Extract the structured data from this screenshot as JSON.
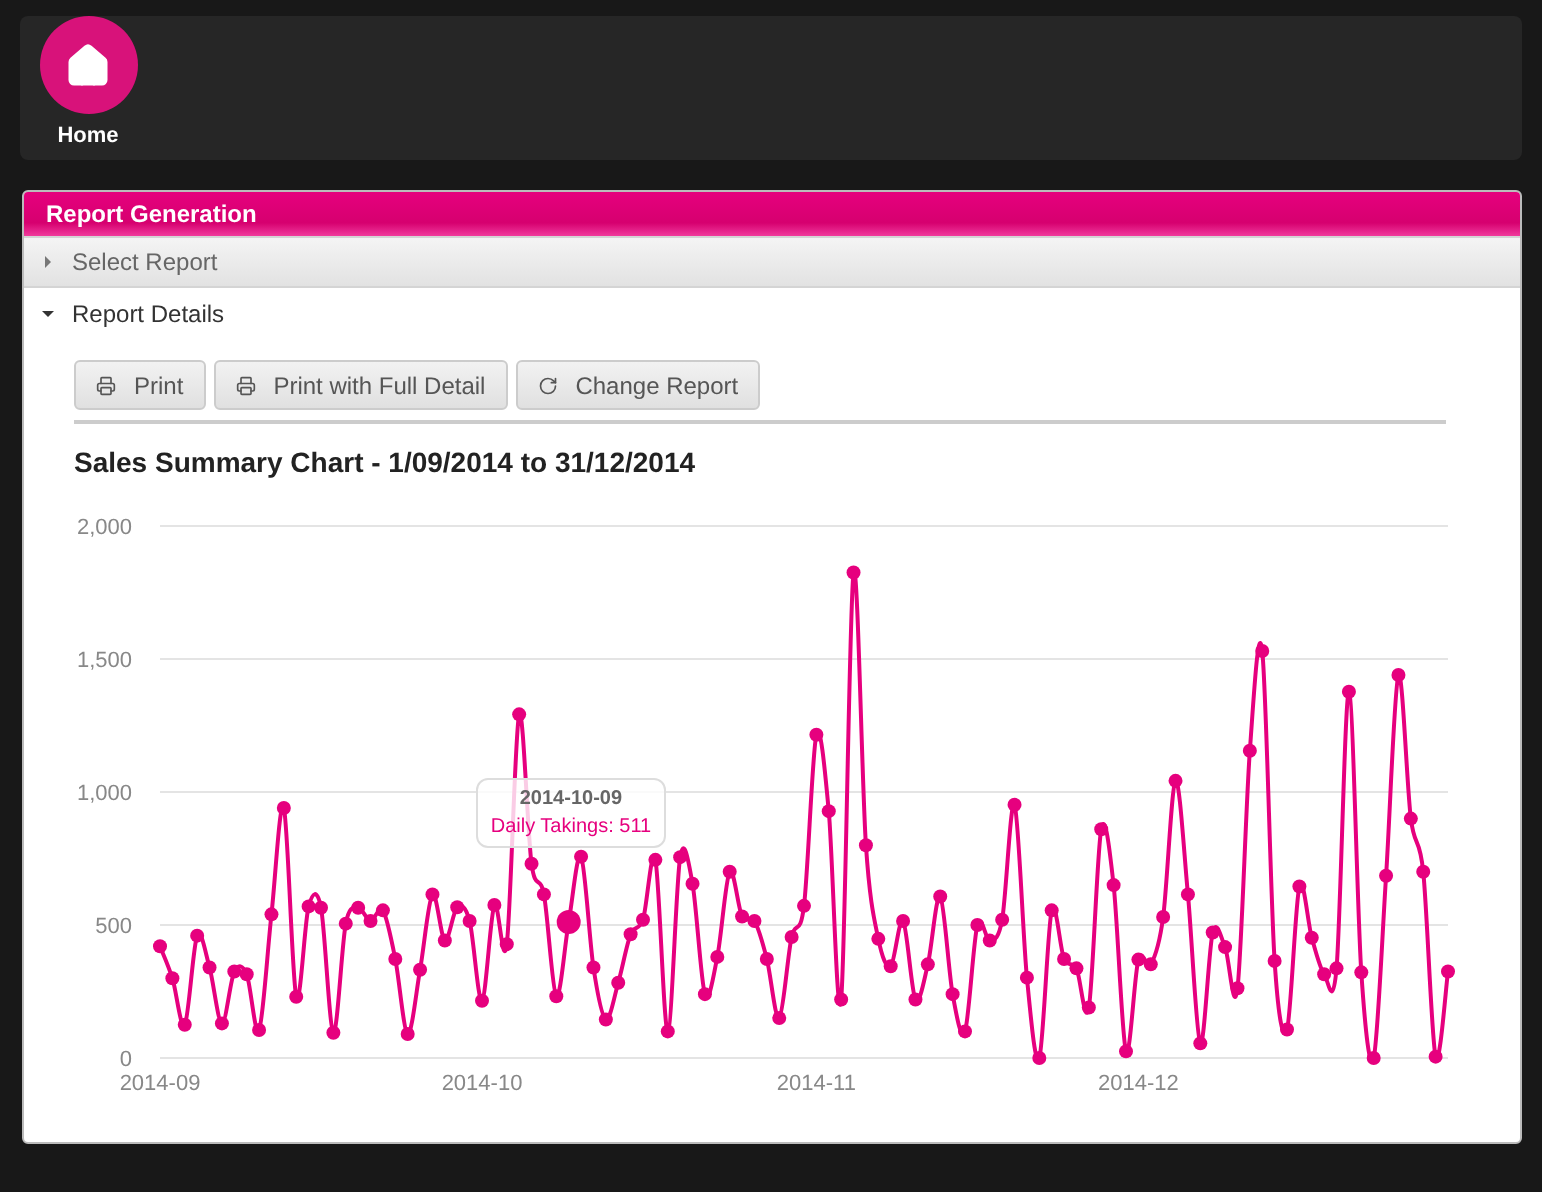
{
  "nav": {
    "items": [
      {
        "label": "Home",
        "selected": true
      }
    ]
  },
  "panel": {
    "title": "Report Generation",
    "sections": [
      {
        "label": "Select Report",
        "expanded": false
      },
      {
        "label": "Report Details",
        "expanded": true
      }
    ],
    "buttons": [
      {
        "label": "Print",
        "kind": "print"
      },
      {
        "label": "Print with Full Detail",
        "kind": "print"
      },
      {
        "label": "Change Report",
        "kind": "change"
      }
    ],
    "report_title": "Sales Summary Chart - 1/09/2014 to 31/12/2014",
    "tooltip": {
      "date": "2014-10-09",
      "text": "Daily Takings: 511"
    },
    "chart_data": {
      "type": "line",
      "grid": true,
      "ylim": [
        0,
        2000
      ],
      "categories": [
        "2014-09",
        null,
        null,
        null,
        null,
        null,
        null,
        null,
        null,
        null,
        null,
        null,
        null,
        null,
        null,
        null,
        null,
        null,
        null,
        null,
        null,
        null,
        null,
        null,
        null,
        null,
        "2014-10",
        null,
        null,
        null,
        null,
        null,
        null,
        null,
        null,
        null,
        null,
        null,
        null,
        null,
        null,
        null,
        null,
        null,
        null,
        null,
        null,
        null,
        null,
        null,
        null,
        null,
        null,
        "2014-11",
        null,
        null,
        null,
        null,
        null,
        null,
        null,
        null,
        null,
        null,
        null,
        null,
        null,
        null,
        null,
        null,
        null,
        null,
        null,
        null,
        null,
        null,
        null,
        null,
        null,
        "2014-12",
        null,
        null,
        null,
        null,
        null,
        null,
        null,
        null,
        null,
        null,
        null,
        null,
        null,
        null,
        null,
        null,
        null,
        null,
        null,
        null,
        null,
        null,
        null,
        null,
        null
      ],
      "yticks": [
        {
          "value": 0,
          "label": "0"
        },
        {
          "value": 500,
          "label": "500"
        },
        {
          "value": 1000,
          "label": "1,000"
        },
        {
          "value": 1500,
          "label": "1,500"
        },
        {
          "value": 2000,
          "label": "2,000"
        }
      ],
      "series": [
        {
          "color": "#e6007e",
          "marker": "circle",
          "values": [
            420,
            300,
            125,
            460,
            340,
            130,
            325,
            315,
            105,
            540,
            940,
            230,
            570,
            565,
            95,
            505,
            565,
            515,
            555,
            372,
            90,
            332,
            615,
            442,
            567,
            515,
            215,
            575,
            428,
            1292,
            730,
            615,
            232,
            511,
            757,
            340,
            145,
            283,
            465,
            520,
            745,
            100,
            755,
            655,
            240,
            380,
            700,
            532,
            515,
            372,
            150,
            455,
            572,
            1215,
            928,
            220,
            1825,
            800,
            448,
            345,
            515,
            220,
            352,
            607,
            240,
            100,
            500,
            442,
            520,
            952,
            302,
            0,
            555,
            372,
            337,
            190,
            860,
            650,
            25,
            370,
            352,
            530,
            1042,
            615,
            55,
            472,
            417,
            262,
            1155,
            1530,
            365,
            107,
            645,
            452,
            315,
            337,
            1377,
            322,
            0,
            685,
            1440,
            900,
            700,
            5,
            325
          ]
        }
      ]
    }
  }
}
